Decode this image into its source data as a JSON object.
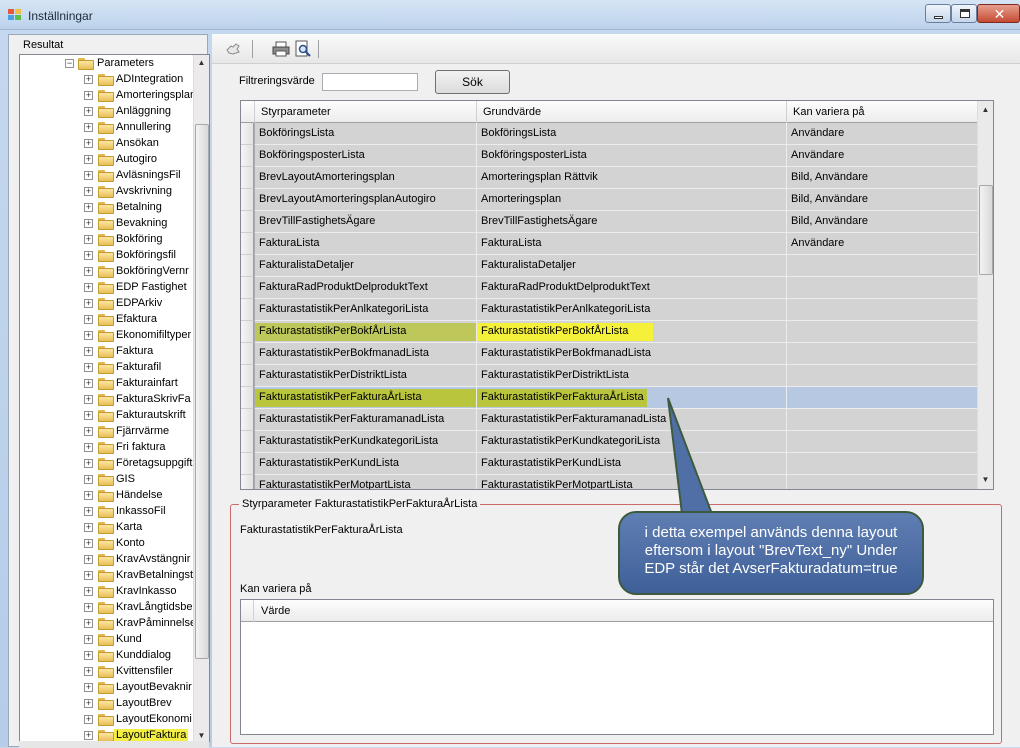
{
  "window": {
    "title": "Inställningar",
    "close_glyph": "✕"
  },
  "left_panel": {
    "title": "Resultat",
    "tree": {
      "root": "Parameters",
      "items": [
        "ADIntegration",
        "Amorteringsplan",
        "Anläggning",
        "Annullering",
        "Ansökan",
        "Autogiro",
        "AvläsningsFil",
        "Avskrivning",
        "Betalning",
        "Bevakning",
        "Bokföring",
        "Bokföringsfil",
        "BokföringVernr",
        "EDP Fastighet",
        "EDPArkiv",
        "Efaktura",
        "Ekonomifiltyper",
        "Faktura",
        "Fakturafil",
        "Fakturainfart",
        "FakturaSkrivFa",
        "Fakturautskrift",
        "Fjärrvärme",
        "Fri faktura",
        "Företagsuppgift",
        "GIS",
        "Händelse",
        "InkassoFil",
        "Karta",
        "Konto",
        "KravAvstängnir",
        "KravBetalningst",
        "KravInkasso",
        "KravLångtidsbe",
        "KravPåminnelse",
        "Kund",
        "Kunddialog",
        "Kvittensfiler",
        "LayoutBevaknir",
        "LayoutBrev",
        "LayoutEkonomi",
        "LayoutFaktura"
      ],
      "selected": "LayoutFaktura"
    }
  },
  "toolbar": {
    "icons": [
      "hand-icon",
      "print-icon",
      "print-preview-icon"
    ]
  },
  "filter": {
    "label": "Filtreringsvärde",
    "value": "",
    "button": "Sök"
  },
  "grid": {
    "columns": [
      "Styrparameter",
      "Grundvärde",
      "Kan variera på"
    ],
    "rows": [
      [
        "BokföringsLista",
        "BokföringsLista",
        "Användare"
      ],
      [
        "BokföringsposterLista",
        "BokföringsposterLista",
        "Användare"
      ],
      [
        "BrevLayoutAmorteringsplan",
        "Amorteringsplan Rättvik",
        "Bild, Användare"
      ],
      [
        "BrevLayoutAmorteringsplanAutogiro",
        "Amorteringsplan",
        "Bild, Användare"
      ],
      [
        "BrevTillFastighetsÄgare",
        "BrevTillFastighetsÄgare",
        "Bild, Användare"
      ],
      [
        "FakturaLista",
        "FakturaLista",
        "Användare"
      ],
      [
        "FakturalistaDetaljer",
        "FakturalistaDetaljer",
        ""
      ],
      [
        "FakturaRadProduktDelproduktText",
        "FakturaRadProduktDelproduktText",
        ""
      ],
      [
        "FakturastatistikPerAnlkategoriLista",
        "FakturastatistikPerAnlkategoriLista",
        ""
      ],
      [
        "FakturastatistikPerBokfÅrLista",
        "FakturastatistikPerBokfÅrLista",
        ""
      ],
      [
        "FakturastatistikPerBokfmanadLista",
        "FakturastatistikPerBokfmanadLista",
        ""
      ],
      [
        "FakturastatistikPerDistriktLista",
        "FakturastatistikPerDistriktLista",
        ""
      ],
      [
        "FakturastatistikPerFakturaÅrLista",
        "FakturastatistikPerFakturaÅrLista",
        ""
      ],
      [
        "FakturastatistikPerFakturamanadLista",
        "FakturastatistikPerFakturamanadLista",
        ""
      ],
      [
        "FakturastatistikPerKundkategoriLista",
        "FakturastatistikPerKundkategoriLista",
        ""
      ],
      [
        "FakturastatistikPerKundLista",
        "FakturastatistikPerKundLista",
        ""
      ],
      [
        "FakturastatistikPerMotpartLista",
        "FakturastatistikPerMotpartLista",
        ""
      ]
    ],
    "current_row": 12,
    "highlighted_rows": [
      9,
      12
    ],
    "highlight_colors": {
      "yellow": "#f5f13b",
      "olive": "#b9c53c"
    }
  },
  "detail": {
    "group_title": "Styrparameter FakturastatistikPerFakturaÅrLista",
    "grundvarde": "FakturastatistikPerFakturaÅrLista",
    "kan_variera_label": "Kan variera på",
    "varde_column": "Värde"
  },
  "callout": {
    "lines": [
      "i detta exempel används denna layout",
      "eftersom i layout \"BrevText_ny\" Under",
      "EDP står det AvserFakturadatum=true"
    ]
  }
}
